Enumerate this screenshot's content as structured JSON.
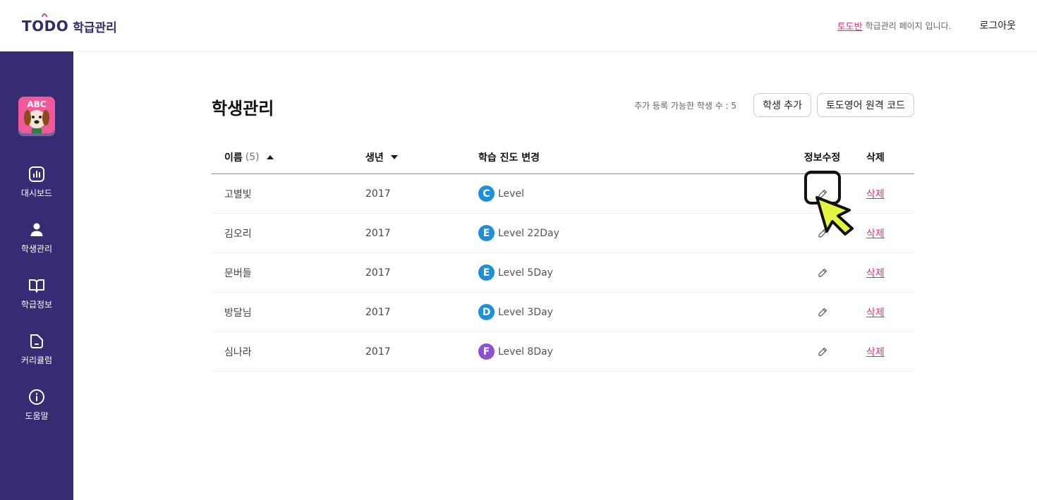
{
  "header": {
    "logo_brand": "TODO",
    "logo_sub": "학급관리",
    "class_name": "토도반",
    "notice": "학급관리 페이지 입니다.",
    "logout": "로그아웃"
  },
  "sidebar": {
    "items": [
      {
        "label": "대시보드",
        "icon": "dashboard-icon"
      },
      {
        "label": "학생관리",
        "icon": "user-icon"
      },
      {
        "label": "학급정보",
        "icon": "book-icon"
      },
      {
        "label": "커리큘럼",
        "icon": "folder-icon"
      },
      {
        "label": "도움말",
        "icon": "info-icon"
      }
    ],
    "avatar_text": "ABC"
  },
  "main": {
    "title": "학생관리",
    "available_label": "추가 등록 가능한 학생 수 : 5",
    "add_student_button": "학생 추가",
    "remote_code_button": "토도영어 원격 코드"
  },
  "table": {
    "headers": {
      "name": "이름",
      "count": "(5)",
      "year": "생년",
      "level": "학습 진도 변경",
      "edit": "정보수정",
      "delete": "삭제"
    },
    "rows": [
      {
        "name": "고별빛",
        "year": "2017",
        "badge": "C",
        "badge_color": "#1e90d8",
        "level": "Level",
        "delete": "삭제"
      },
      {
        "name": "김오리",
        "year": "2017",
        "badge": "E",
        "badge_color": "#1e90d8",
        "level": "Level 22Day",
        "delete": "삭제"
      },
      {
        "name": "문버들",
        "year": "2017",
        "badge": "E",
        "badge_color": "#1e90d8",
        "level": "Level 5Day",
        "delete": "삭제"
      },
      {
        "name": "방달님",
        "year": "2017",
        "badge": "D",
        "badge_color": "#1e90d8",
        "level": "Level 3Day",
        "delete": "삭제"
      },
      {
        "name": "심나라",
        "year": "2017",
        "badge": "F",
        "badge_color": "#8e4fd6",
        "level": "Level 8Day",
        "delete": "삭제"
      }
    ]
  },
  "colors": {
    "sidebar": "#372b73",
    "accent": "#d6347a",
    "cursor": "#e4f542"
  }
}
